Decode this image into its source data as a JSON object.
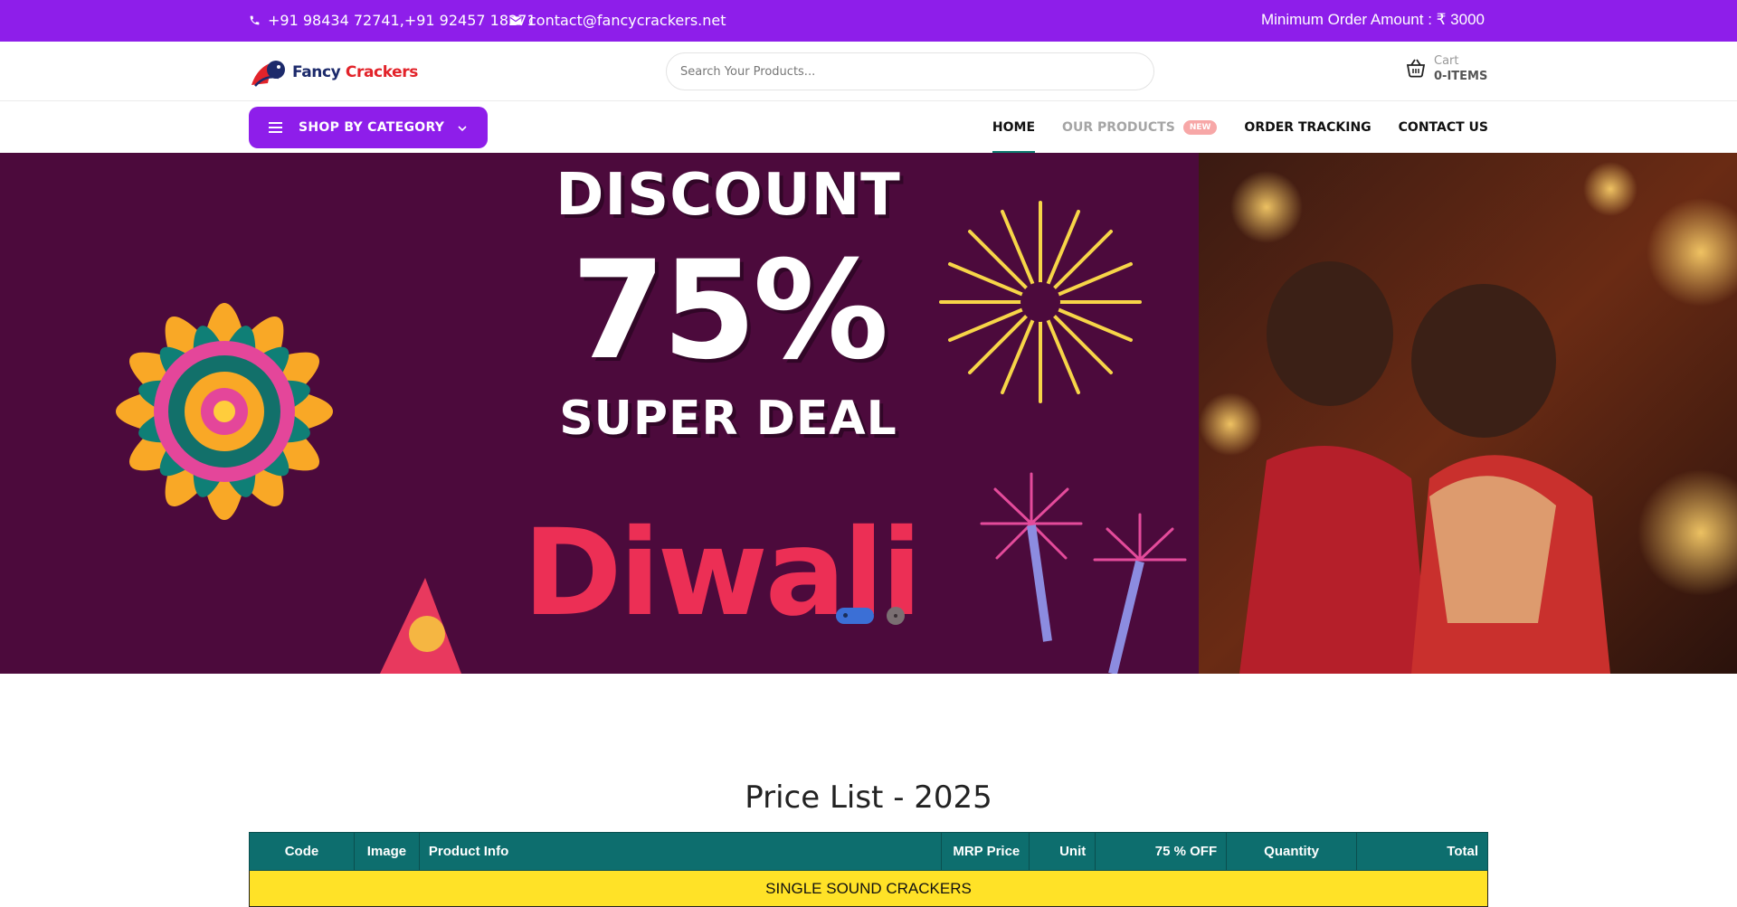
{
  "topbar": {
    "phones": "+91 98434 72741,+91 92457 18271",
    "email": "contact@fancycrackers.net",
    "min_order": "Minimum Order Amount : ₹ 3000",
    "icons": [
      "phone-icon",
      "envelope-icon"
    ]
  },
  "header": {
    "logo": {
      "word1": "Fancy",
      "word2": "Crackers"
    },
    "search_placeholder": "Search Your Products...",
    "cart": {
      "label": "Cart",
      "count": "0-ITEMS",
      "icon": "basket-icon"
    }
  },
  "nav": {
    "shop_by_category": "SHOP BY CATEGORY",
    "menu": {
      "home": "HOME",
      "products": "OUR PRODUCTS",
      "products_badge": "NEW",
      "tracking": "ORDER TRACKING",
      "contact": "CONTACT US"
    }
  },
  "banner": {
    "line1": "DISCOUNT",
    "line2": "75%",
    "line3": "SUPER DEAL",
    "line4": "Diwali",
    "slides": 2,
    "active_slide": 1
  },
  "price_list": {
    "title": "Price List - 2025",
    "columns": [
      "Code",
      "Image",
      "Product Info",
      "MRP Price",
      "Unit",
      "75 % OFF",
      "Quantity",
      "Total"
    ],
    "first_category": "SINGLE SOUND CRACKERS"
  },
  "colors": {
    "brand_purple": "#8e1eea",
    "table_header": "#0d6e6e",
    "category_row": "#ffe227",
    "banner_bg": "#4c0a3c"
  }
}
